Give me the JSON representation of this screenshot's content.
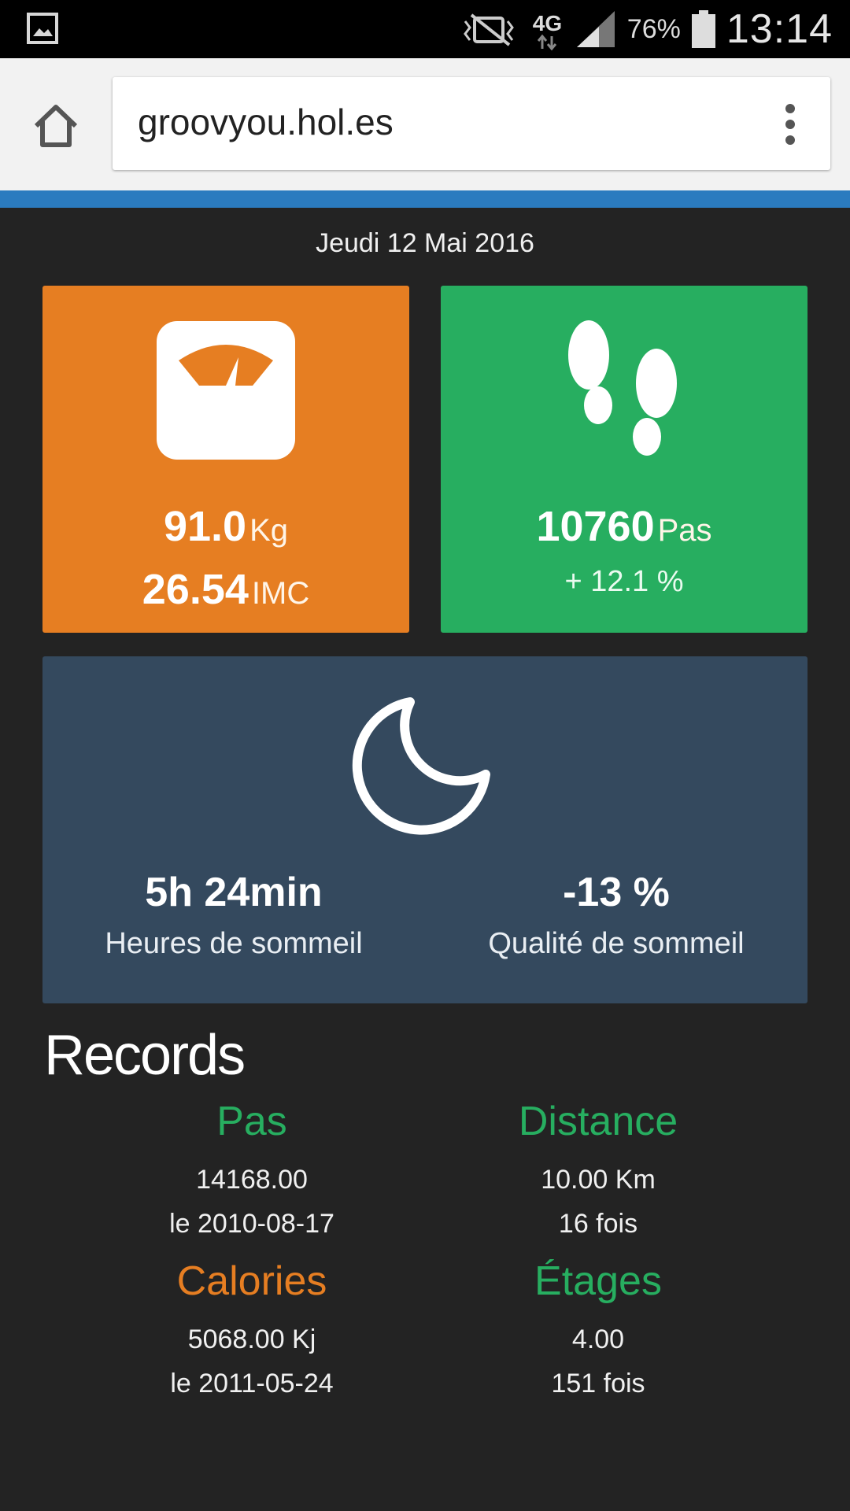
{
  "status_bar": {
    "network": "4G",
    "battery": "76%",
    "time": "13:14",
    "icons": [
      "gallery-icon",
      "mute-icon",
      "network-icon",
      "signal-icon",
      "battery-icon"
    ]
  },
  "browser": {
    "url": "groovyou.hol.es",
    "icons": [
      "home-icon",
      "overflow-menu-icon"
    ]
  },
  "dashboard": {
    "date": "Jeudi 12 Mai 2016",
    "weight": {
      "value": "91.0",
      "unit": "Kg",
      "bmi": "26.54",
      "bmi_unit": "IMC",
      "color": "#e67e22",
      "icon": "scale-icon"
    },
    "steps": {
      "value": "10760",
      "unit": "Pas",
      "change": "+ 12.1 %",
      "color": "#27ae60",
      "icon": "footprints-icon"
    },
    "sleep": {
      "duration": "5h 24min",
      "duration_label": "Heures de sommeil",
      "quality": "-13 %",
      "quality_label": "Qualité de sommeil",
      "color": "#34495e",
      "icon": "moon-icon"
    }
  },
  "records": {
    "title": "Records",
    "items": [
      {
        "label": "Pas",
        "line1": "14168.00",
        "line2": "le 2010-08-17",
        "color": "#27ae60"
      },
      {
        "label": "Distance",
        "line1": "10.00 Km",
        "line2": "16 fois",
        "color": "#27ae60"
      },
      {
        "label": "Calories",
        "line1": "5068.00 Kj",
        "line2": "le 2011-05-24",
        "color": "#e67e22"
      },
      {
        "label": "Étages",
        "line1": "4.00",
        "line2": "151 fois",
        "color": "#27ae60"
      }
    ]
  }
}
